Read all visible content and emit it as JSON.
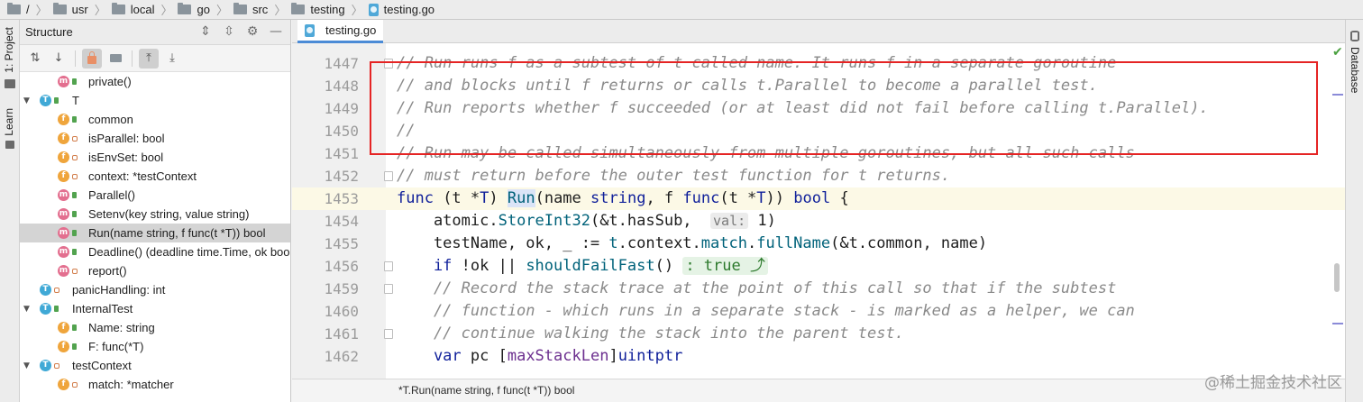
{
  "breadcrumb": {
    "items": [
      "/",
      "usr",
      "local",
      "go",
      "src",
      "testing"
    ],
    "file": "testing.go"
  },
  "left_strip": {
    "project": "1: Project",
    "learn": "Learn"
  },
  "structure": {
    "title": "Structure",
    "items": [
      {
        "badge": "m",
        "label": "private()",
        "vis": "public"
      },
      {
        "badge": "T",
        "label": "T",
        "expanded": true
      },
      {
        "badge": "f",
        "label": "common",
        "vis": "public"
      },
      {
        "badge": "f",
        "label": "isParallel: bool",
        "vis": "private"
      },
      {
        "badge": "f",
        "label": "isEnvSet: bool",
        "vis": "private"
      },
      {
        "badge": "f",
        "label": "context: *testContext",
        "vis": "private"
      },
      {
        "badge": "m",
        "label": "Parallel()",
        "vis": "public"
      },
      {
        "badge": "m",
        "label": "Setenv(key string, value string)",
        "vis": "public"
      },
      {
        "badge": "m",
        "label": "Run(name string, f func(t *T)) bool",
        "vis": "public",
        "selected": true
      },
      {
        "badge": "m",
        "label": "Deadline() (deadline time.Time, ok bool)",
        "vis": "public"
      },
      {
        "badge": "m",
        "label": "report()",
        "vis": "private"
      },
      {
        "badge": "T",
        "label": "panicHandling: int"
      },
      {
        "badge": "T",
        "label": "InternalTest",
        "expanded": true
      },
      {
        "badge": "f",
        "label": "Name: string",
        "vis": "public"
      },
      {
        "badge": "f",
        "label": "F: func(*T)",
        "vis": "public"
      },
      {
        "badge": "T",
        "label": "testContext",
        "expanded": true
      },
      {
        "badge": "f",
        "label": "match: *matcher",
        "vis": "private"
      }
    ]
  },
  "editor": {
    "tab": "testing.go",
    "lines": {
      "n1447": "1447",
      "t1447": "// Run runs f as a subtest of t called name. It runs f in a separate goroutine",
      "n1448": "1448",
      "t1448": "// and blocks until f returns or calls t.Parallel to become a parallel test.",
      "n1449": "1449",
      "t1449": "// Run reports whether f succeeded (or at least did not fail before calling t.Parallel).",
      "n1450": "1450",
      "t1450": "//",
      "n1451": "1451",
      "t1451": "// Run may be called simultaneously from multiple goroutines, but all such calls",
      "n1452": "1452",
      "t1452": "// must return before the outer test function for t returns.",
      "n1453": "1453",
      "n1454": "1454",
      "n1455": "1455",
      "n1456": "1456",
      "n1459": "1459",
      "t1459": "    // Record the stack trace at the point of this call so that if the subtest",
      "n1460": "1460",
      "t1460": "    // function - which runs in a separate stack - is marked as a helper, we can",
      "n1461": "1461",
      "t1461": "    // continue walking the stack into the parent test.",
      "n1462": "1462"
    },
    "tokens": {
      "func": "func",
      "recv": " (t *",
      "T": "T",
      "recvend": ") ",
      "Run": "Run",
      "params": "(name ",
      "string": "string",
      "comma": ", f ",
      "func2": "func",
      "p2": "(t *",
      "T2": "T",
      "p3": ")) ",
      "bool": "bool",
      "brace": " {",
      "atomic": "    atomic.",
      "StoreInt32": "StoreInt32",
      "a2": "(&t.hasSub,  ",
      "valhint": "val:",
      "one": " 1",
      "a3": ")",
      "tn": "    testName, ok, _ := ",
      "tctx": "t",
      "tctx2": ".context.",
      "match": "match",
      "dot": ".",
      "fullName": "fullName",
      "fnargs": "(&t.common, name)",
      "if": "    if",
      "notok": " !ok || ",
      "sff": "shouldFailFast",
      "paren": "() ",
      "truehint": ": true ⤴",
      "var": "    var",
      "pc": " pc [",
      "maxStackLen": "maxStackLen",
      "rb": "]",
      "uintptr": "uintptr"
    },
    "status": "*T.Run(name string, f func(t *T)) bool"
  },
  "right_strip": {
    "database": "Database"
  },
  "watermark": "@稀土掘金技术社区"
}
